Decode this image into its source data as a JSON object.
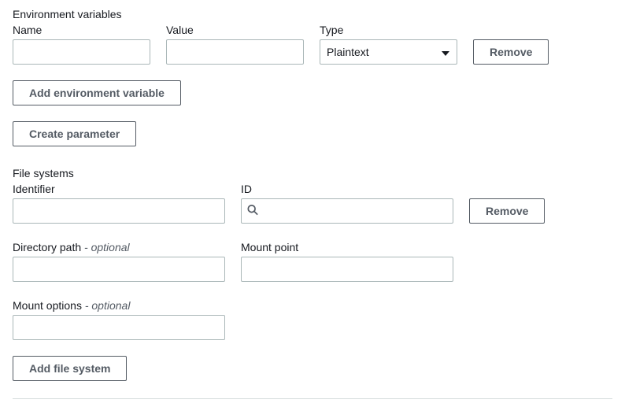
{
  "env": {
    "section_title": "Environment variables",
    "name_label": "Name",
    "value_label": "Value",
    "type_label": "Type",
    "type_selected": "Plaintext",
    "name_value": "",
    "value_value": "",
    "remove_label": "Remove",
    "add_var_label": "Add environment variable",
    "create_param_label": "Create parameter"
  },
  "fs": {
    "section_title": "File systems",
    "identifier_label": "Identifier",
    "id_label": "ID",
    "remove_label": "Remove",
    "identifier_value": "",
    "id_value": "",
    "dir_path_label": "Directory path",
    "dir_path_optional": " - optional",
    "dir_path_value": "",
    "mount_point_label": "Mount point",
    "mount_point_value": "",
    "mount_options_label": "Mount options",
    "mount_options_optional": " - optional",
    "mount_options_value": "",
    "add_fs_label": "Add file system"
  }
}
